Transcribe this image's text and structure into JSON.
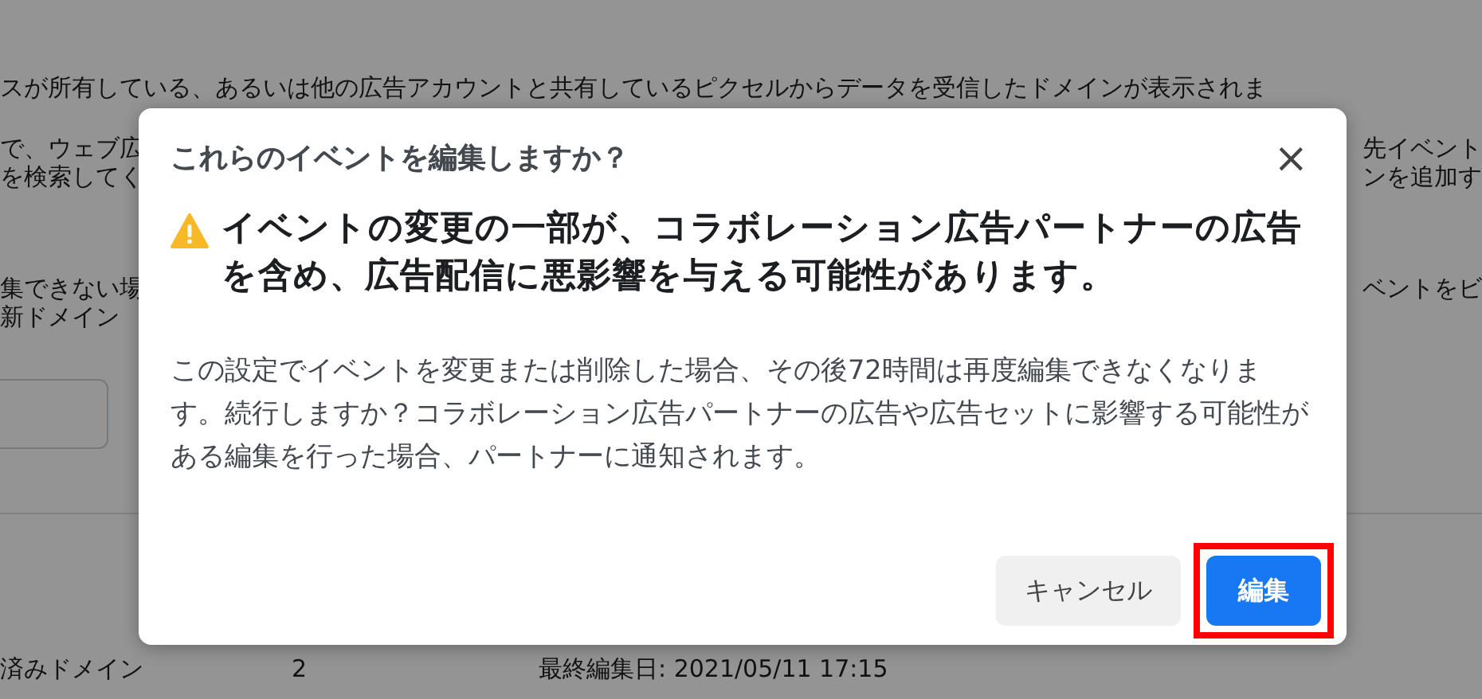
{
  "background": {
    "lines": [
      {
        "left": "スが所有している、あるいは他の広告アカウントと共有しているピクセルからデータを受信したドメインが表示されま"
      },
      {
        "left": "で、ウェブ広",
        "right": "先イベント"
      },
      {
        "left": "を検索してく",
        "right": "ンを追加す"
      },
      {
        "left": "集できない場",
        "right": "ベントをビ"
      },
      {
        "left": "新ドメイン"
      }
    ],
    "row": {
      "name": "済みドメイン",
      "count": "2",
      "edited": "最終編集日: 2021/05/11 17:15"
    }
  },
  "dialog": {
    "title": "これらのイベントを編集しますか？",
    "close": "×",
    "warning": "イベントの変更の一部が、コラボレーション広告パートナーの広告を含め、広告配信に悪影響を与える可能性があります。",
    "body": "この設定でイベントを変更または削除した場合、その後72時間は再度編集できなくなります。続行しますか？コラボレーション広告パートナーの広告や広告セットに影響する可能性がある編集を行った場合、パートナーに通知されます。",
    "buttons": [
      {
        "label": "キャンセル",
        "kind": "secondary",
        "highlighted": false
      },
      {
        "label": "編集",
        "kind": "primary",
        "highlighted": true
      }
    ]
  }
}
